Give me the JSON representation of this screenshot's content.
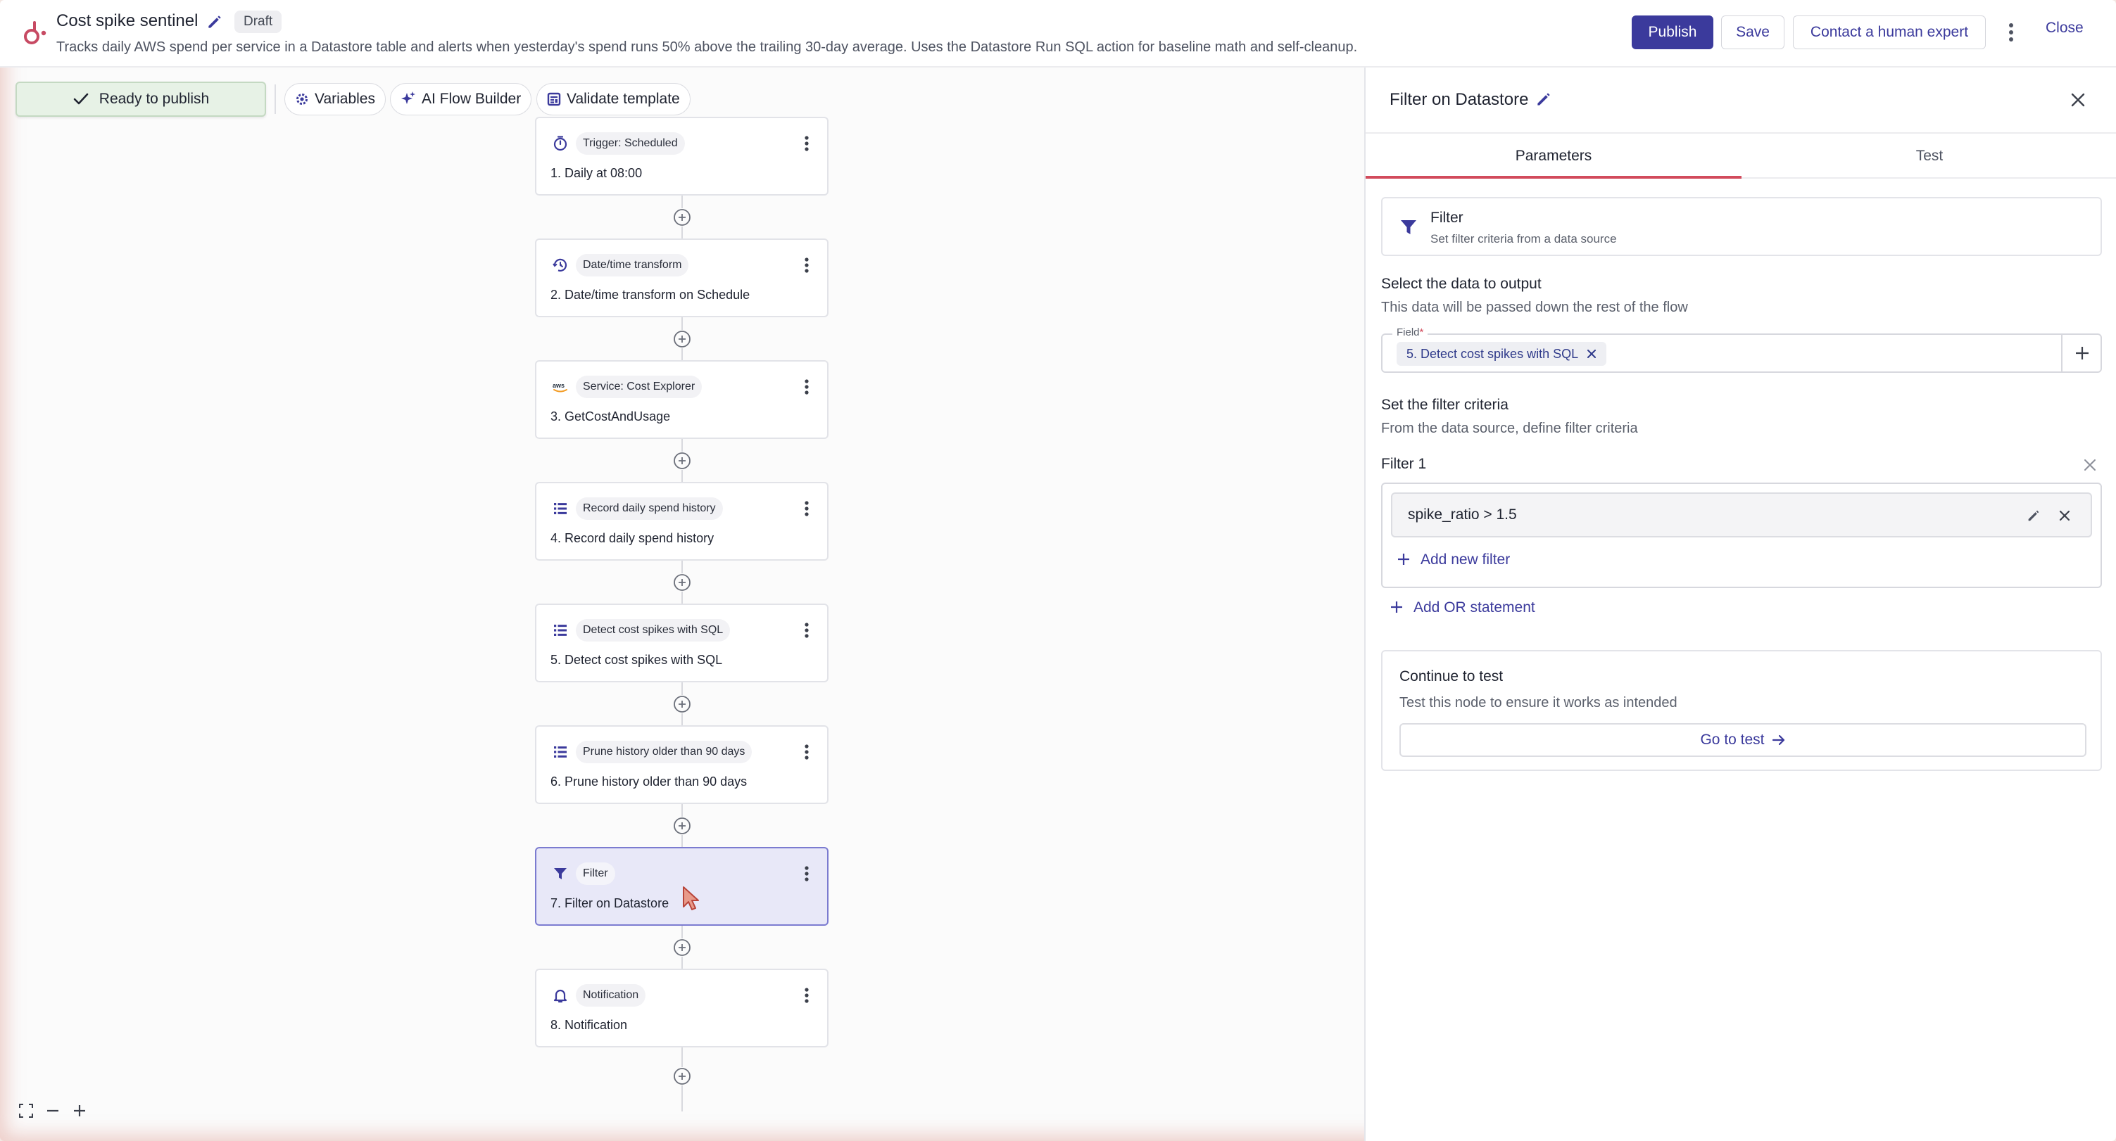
{
  "header": {
    "title": "Cost spike sentinel",
    "badge": "Draft",
    "subtitle": "Tracks daily AWS spend per service in a Datastore table and alerts when yesterday's spend runs 50% above the trailing 30-day average. Uses the Datastore Run SQL action for baseline math and self-cleanup.",
    "publish_label": "Publish",
    "save_label": "Save",
    "expert_label": "Contact a human expert",
    "close_label": "Close"
  },
  "toolbar": {
    "ready_label": "Ready to publish",
    "variables_label": "Variables",
    "ai_label": "AI Flow Builder",
    "validate_label": "Validate template"
  },
  "flow": {
    "nodes": [
      {
        "icon": "timer-icon",
        "type": "Trigger: Scheduled",
        "name": "1. Daily at 08:00",
        "selected": false
      },
      {
        "icon": "calendar-clock-icon",
        "type": "Date/time transform",
        "name": "2. Date/time transform on Schedule",
        "selected": false
      },
      {
        "icon": "aws-logo-icon",
        "type": "Service: Cost Explorer",
        "name": "3. GetCostAndUsage",
        "selected": false
      },
      {
        "icon": "list-icon",
        "type": "Record daily spend history",
        "name": "4. Record daily spend history",
        "selected": false
      },
      {
        "icon": "list-icon",
        "type": "Detect cost spikes with SQL",
        "name": "5. Detect cost spikes with SQL",
        "selected": false
      },
      {
        "icon": "list-icon",
        "type": "Prune history older than 90 days",
        "name": "6. Prune history older than 90 days",
        "selected": false
      },
      {
        "icon": "funnel-icon",
        "type": "Filter",
        "name": "7. Filter on Datastore",
        "selected": true
      },
      {
        "icon": "bell-icon",
        "type": "Notification",
        "name": "8. Notification",
        "selected": false
      }
    ]
  },
  "panel": {
    "title": "Filter on Datastore",
    "tabs": [
      {
        "label": "Parameters",
        "active": true
      },
      {
        "label": "Test",
        "active": false
      }
    ],
    "filter_card": {
      "title": "Filter",
      "description": "Set filter criteria from a data source"
    },
    "output": {
      "title": "Select the data to output",
      "description": "This data will be passed down the rest of the flow",
      "field_label": "Field",
      "field_required": "*",
      "field_value": "5. Detect cost spikes with SQL"
    },
    "criteria": {
      "title": "Set the filter criteria",
      "description": "From the data source, define filter criteria",
      "group_label": "Filter 1",
      "condition": "spike_ratio > 1.5",
      "add_filter_label": "Add new filter",
      "add_or_label": "Add OR statement"
    },
    "test_card": {
      "title": "Continue to test",
      "description": "Test this node to ensure it works as intended",
      "button_label": "Go to test"
    }
  },
  "colors": {
    "accent": "#3b3a9c",
    "tab_underline": "#d24b5c",
    "ready_bg": "#e7f2e6",
    "selected_node_bg": "#e8e8f8"
  }
}
